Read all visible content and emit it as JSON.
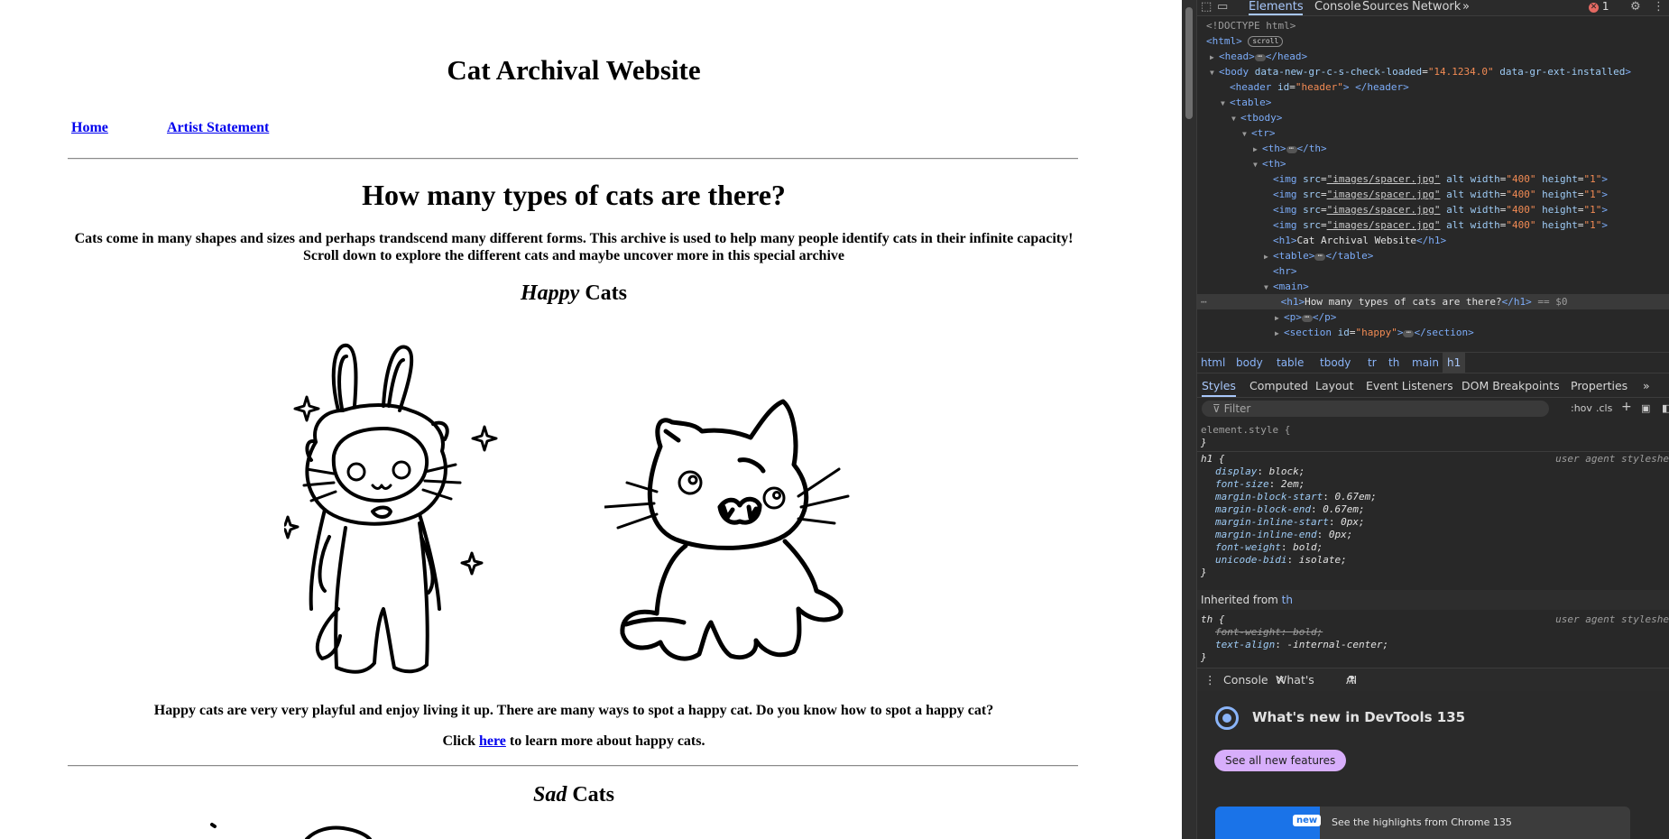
{
  "page": {
    "site_title": "Cat Archival Website",
    "nav": [
      {
        "label": "Home"
      },
      {
        "label": "Artist Statement"
      }
    ],
    "main_heading": "How many types of cats are there?",
    "intro_line1": "Cats come in many shapes and sizes and perhaps trandscend many different forms. This archive is used to help many people identify cats in their infinite capacity!",
    "intro_line2": "Scroll down to explore the different cats and maybe uncover more in this special archive",
    "happy": {
      "heading_em": "Happy",
      "heading_rest": " Cats",
      "text": "Happy cats are very very playful and enjoy living it up. There are many ways to spot a happy cat. Do you know how to spot a happy cat?",
      "click_prefix": "Click ",
      "click_link": "here",
      "click_suffix": " to learn more about happy cats."
    },
    "sad": {
      "heading_em": "Sad",
      "heading_rest": " Cats"
    }
  },
  "devtools": {
    "tabs": [
      "Elements",
      "Console",
      "Sources",
      "Network"
    ],
    "more_tabs": "»",
    "error_count": "1",
    "dom": {
      "doctype": "<!DOCTYPE html>",
      "html_open": "<html>",
      "scroll_badge": "scroll",
      "head": "<head>",
      "head_close": "</head>",
      "body_tag": "body",
      "body_attr1_name": "data-new-gr-c-s-check-loaded",
      "body_attr1_value": "\"14.1234.0\"",
      "body_attr2_name": "data-gr-ext-installed",
      "header_tag": "header",
      "header_id_value": "\"header\"",
      "header_close": "</header>",
      "table": "<table>",
      "tbody": "<tbody>",
      "tr": "<tr>",
      "th_collapsed": "<th>",
      "th_close": "</th>",
      "th_open": "<th>",
      "img_src": "\"images/spacer.jpg\"",
      "img_w": "\"400\"",
      "img_h": "\"1\"",
      "h1_open": "<h1>",
      "h1_text": "Cat Archival Website",
      "h1_close": "</h1>",
      "table_inner": "<table>",
      "table_close": "</table>",
      "hr": "<hr>",
      "main": "<main>",
      "sel_h1_text": "How many types of cats are there?",
      "sel_suffix": "== $0",
      "p_open": "<p>",
      "p_close": "</p>",
      "section_id_value": "\"happy\"",
      "section_close": "</section>"
    },
    "breadcrumbs": [
      "html",
      "body",
      "table",
      "tbody",
      "tr",
      "th",
      "main",
      "h1"
    ],
    "subtabs": [
      "Styles",
      "Computed",
      "Layout",
      "Event Listeners",
      "DOM Breakpoints",
      "Properties"
    ],
    "filter_placeholder": "Filter",
    "hov": ":hov",
    "cls": ".cls",
    "styles": {
      "element_style": "element.style {",
      "close_brace": "}",
      "h1_selector": "h1 {",
      "ua_label": "user agent styleshe",
      "h1_props": [
        {
          "name": "display",
          "value": "block;"
        },
        {
          "name": "font-size",
          "value": "2em;"
        },
        {
          "name": "margin-block-start",
          "value": "0.67em;"
        },
        {
          "name": "margin-block-end",
          "value": "0.67em;"
        },
        {
          "name": "margin-inline-start",
          "value": "0px;"
        },
        {
          "name": "margin-inline-end",
          "value": "0px;"
        },
        {
          "name": "font-weight",
          "value": "bold;"
        },
        {
          "name": "unicode-bidi",
          "value": "isolate;"
        }
      ],
      "inherited_prefix": "Inherited from ",
      "inherited_tag": "th",
      "th_selector": "th {",
      "th_struck": "font-weight: bold;",
      "th_prop_name": "text-align",
      "th_prop_value": "-internal-center;"
    },
    "drawer_tabs": [
      "Console",
      "What's new",
      "AI assistance"
    ],
    "whats_new": {
      "title": "What's new in DevTools 135",
      "button": "See all new features",
      "badge": "new",
      "card_text": "See the highlights from Chrome 135"
    }
  }
}
